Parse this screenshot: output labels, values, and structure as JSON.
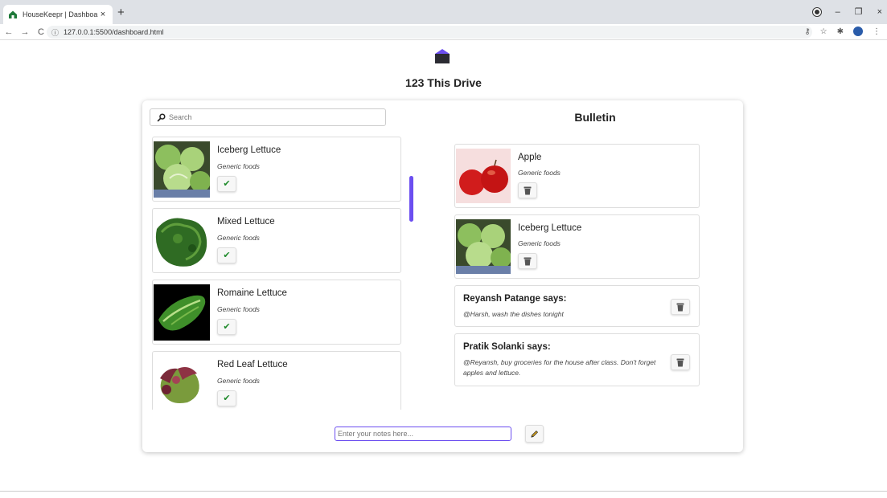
{
  "browser": {
    "tab_title": "HouseKeepr | Dashboard",
    "tab_close": "×",
    "new_tab": "+",
    "url": "127.0.0.1:5500/dashboard.html",
    "back": "←",
    "forward": "→",
    "reload": "C",
    "info": "ⓘ",
    "key": "⚷",
    "star": "☆",
    "puzzle": "✱",
    "menu": "⋮",
    "minimize": "–",
    "restore": "❐",
    "close": "×"
  },
  "house": {
    "name": "123 This Drive",
    "logo_icon": "house-icon"
  },
  "search": {
    "placeholder": "Search"
  },
  "food_list": [
    {
      "name": "Iceberg Lettuce",
      "category": "Generic foods",
      "image": "iceberg"
    },
    {
      "name": "Mixed Lettuce",
      "category": "Generic foods",
      "image": "mixed"
    },
    {
      "name": "Romaine Lettuce",
      "category": "Generic foods",
      "image": "romaine"
    },
    {
      "name": "Red Leaf Lettuce",
      "category": "Generic foods",
      "image": "redleaf"
    }
  ],
  "check_symbol": "✔",
  "bulletin": {
    "title": "Bulletin",
    "food_items": [
      {
        "name": "Apple",
        "category": "Generic foods",
        "image": "apple"
      },
      {
        "name": "Iceberg Lettuce",
        "category": "Generic foods",
        "image": "iceberg"
      }
    ],
    "notes": [
      {
        "author": "Reyansh Patange says:",
        "text": "@Harsh, wash the dishes tonight"
      },
      {
        "author": "Pratik Solanki says:",
        "text": "@Reyansh, buy groceries for the house after class. Don't forget apples and lettuce."
      }
    ]
  },
  "notes_input": {
    "placeholder": "Enter your notes here..."
  },
  "colors": {
    "accent": "#6b4ef0",
    "check": "#1e8a2a",
    "logo_roof": "#6b4ef0",
    "logo_body": "#2b2b33"
  }
}
